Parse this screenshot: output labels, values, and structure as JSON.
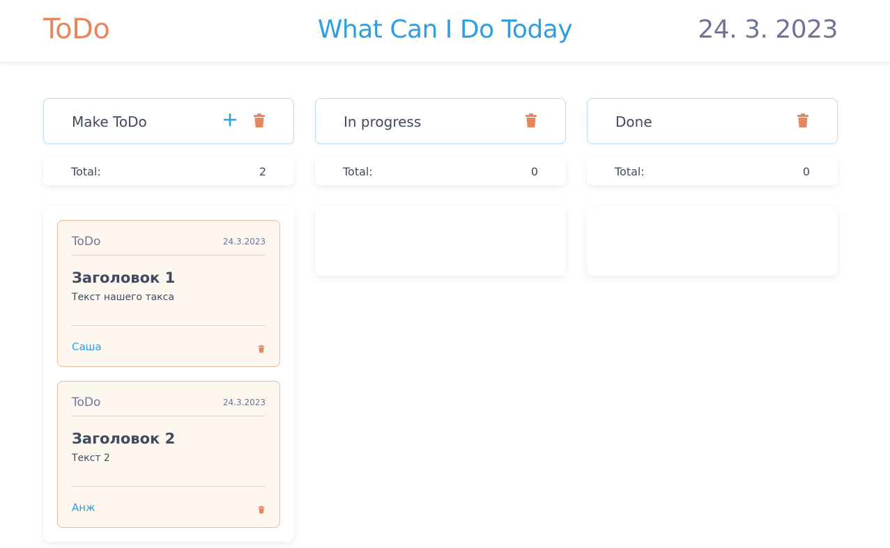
{
  "header": {
    "logo": "ToDo",
    "title": "What Can I Do Today",
    "date": "24. 3. 2023"
  },
  "colors": {
    "accent_orange": "#e6875f",
    "accent_blue": "#2f9ee0",
    "date_gray": "#6f7396"
  },
  "columns": [
    {
      "title": "Make ToDo",
      "total_label": "Total:",
      "total_value": "2",
      "icons": [
        "plus-icon",
        "trash-icon"
      ],
      "cards": [
        {
          "status": "ToDo",
          "date": "24.3.2023",
          "title": "Заголовок 1",
          "text": "Текст нашего такса",
          "author": "Саша"
        },
        {
          "status": "ToDo",
          "date": "24.3.2023",
          "title": "Заголовок 2",
          "text": "Текст 2",
          "author": "Анж"
        }
      ]
    },
    {
      "title": "In progress",
      "total_label": "Total:",
      "total_value": "0",
      "icons": [
        "trash-icon"
      ],
      "cards": []
    },
    {
      "title": "Done",
      "total_label": "Total:",
      "total_value": "0",
      "icons": [
        "trash-icon"
      ],
      "cards": []
    }
  ]
}
